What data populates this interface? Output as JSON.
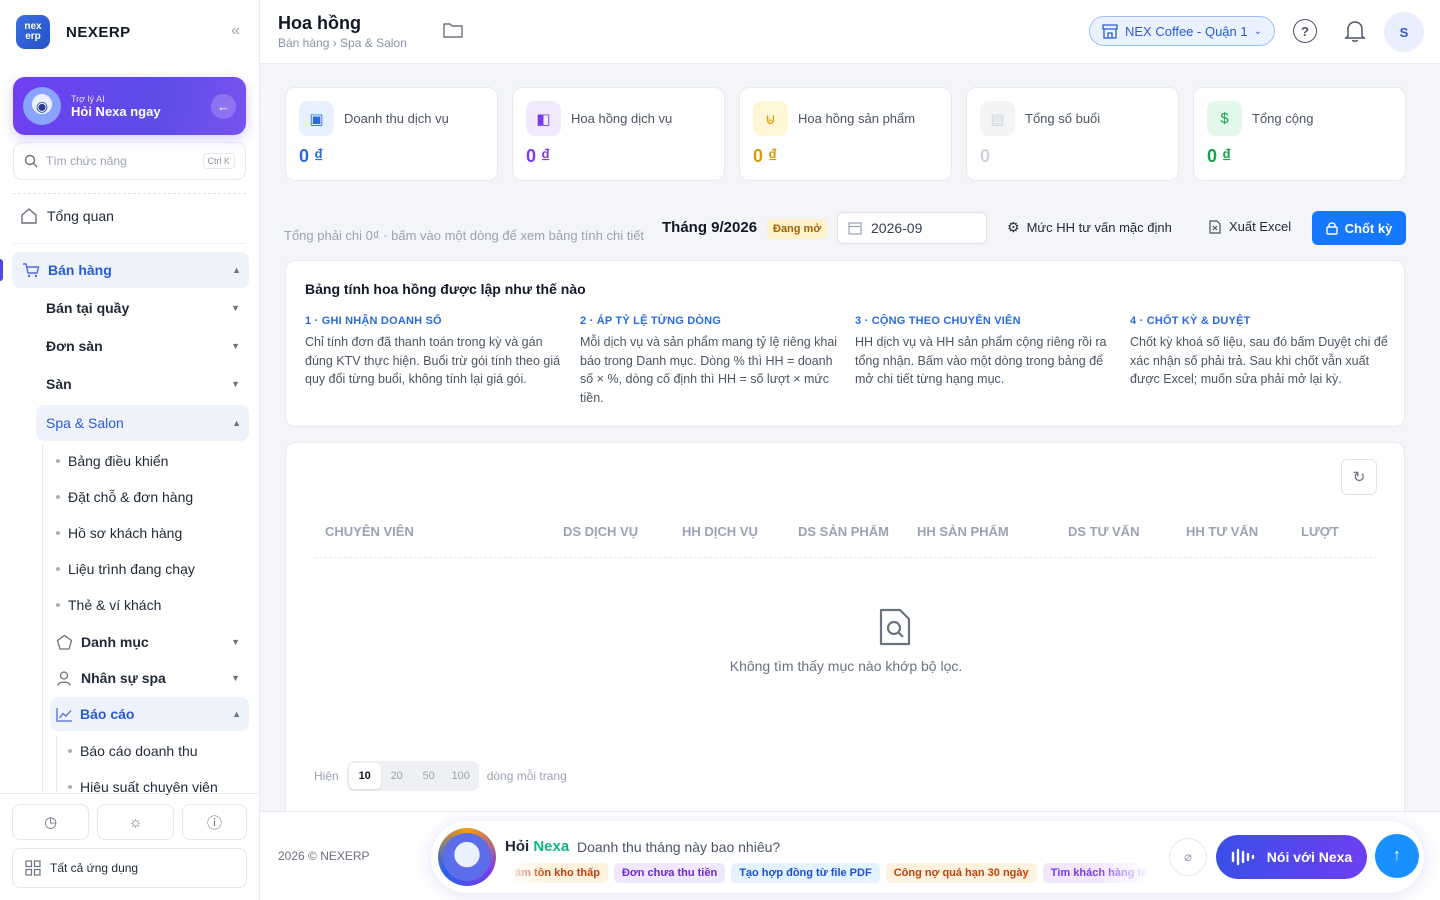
{
  "app": {
    "name": "NEXERP",
    "logo_text": "nex erp"
  },
  "ai_card": {
    "small": "Trợ lý AI",
    "big": "Hỏi Nexa ngay"
  },
  "search": {
    "placeholder": "Tìm chức năng",
    "shortcut": "Ctrl K"
  },
  "nav": {
    "overview": "Tổng quan",
    "sales": "Bán hàng",
    "pos": "Bán tại quầy",
    "marketplace_orders": "Đơn sàn",
    "marketplace": "Sàn",
    "spa": "Spa & Salon",
    "spa_items": [
      "Bảng điều khiển",
      "Đặt chỗ & đơn hàng",
      "Hồ sơ khách hàng",
      "Liệu trình đang chạy",
      "Thẻ & ví khách"
    ],
    "catalog": "Danh mục",
    "staff": "Nhân sự spa",
    "reports": "Báo cáo",
    "report_items": [
      "Báo cáo doanh thu",
      "Hiệu suất chuyên viên"
    ],
    "all_apps": "Tất cả ứng dụng"
  },
  "header": {
    "title": "Hoa hồng",
    "breadcrumb": "Bán hàng › Spa & Salon",
    "store": "NEX Coffee - Quận 1",
    "user_initial": "S"
  },
  "stats": [
    {
      "label": "Doanh thu dịch vụ",
      "value": "0 ₫",
      "color": "#2a6ae0"
    },
    {
      "label": "Hoa hồng dịch vụ",
      "value": "0 ₫",
      "color": "#7c3aed"
    },
    {
      "label": "Hoa hồng sản phẩm",
      "value": "0 ₫",
      "color": "#d99a06"
    },
    {
      "label": "Tổng số buổi",
      "value": "0",
      "color": "#d1d5db"
    },
    {
      "label": "Tổng cộng",
      "value": "0 ₫",
      "color": "#16a34a"
    }
  ],
  "filters": {
    "hint": "Tổng phải chi 0₫ · bấm vào một dòng để xem bảng tính chi tiết",
    "month": "Tháng 9/2026",
    "status": "Đang mở",
    "period": "2026-09",
    "default_rate": "Mức HH tư vấn mặc định",
    "export": "Xuất Excel",
    "close_period": "Chốt kỳ"
  },
  "explain": {
    "title": "Bảng tính hoa hồng được lập như thế nào",
    "steps": [
      {
        "title": "1 · GHI NHẬN DOANH SỐ",
        "text": "Chỉ tính đơn đã thanh toán trong kỳ và gán đúng KTV thực hiện. Buổi trừ gói tính theo giá quy đổi từng buổi, không tính lại giá gói."
      },
      {
        "title": "2 · ÁP TỶ LỆ TỪNG DÒNG",
        "text": "Mỗi dịch vụ và sản phẩm mang tỷ lệ riêng khai báo trong Danh mục. Dòng % thì HH = doanh số × %, dòng cố định thì HH = số lượt × mức tiền."
      },
      {
        "title": "3 · CỘNG THEO CHUYÊN VIÊN",
        "text": "HH dịch vụ và HH sản phẩm cộng riêng rồi ra tổng nhận. Bấm vào một dòng trong bảng để mở chi tiết từng hạng mục."
      },
      {
        "title": "4 · CHỐT KỲ & DUYỆT",
        "text": "Chốt kỳ khoá số liệu, sau đó bấm Duyệt chi để xác nhận số phải trả. Sau khi chốt vẫn xuất được Excel; muốn sửa phải mở lại kỳ."
      }
    ]
  },
  "table": {
    "columns": [
      "CHUYÊN VIÊN",
      "DS DỊCH VỤ",
      "HH DỊCH VỤ",
      "DS SẢN PHẨM",
      "HH SẢN PHẨM",
      "DS TƯ VẤN",
      "HH TƯ VẤN",
      "LƯỢT"
    ],
    "empty": "Không tìm thấy mục nào khớp bộ lọc.",
    "pager_prefix": "Hiện",
    "page_sizes": [
      "10",
      "20",
      "50",
      "100"
    ],
    "selected_page_size": "10",
    "pager_suffix": "dòng mỗi trang"
  },
  "footer": {
    "copyright": "2026 © NEXERP",
    "ask_prefix": "Hỏi",
    "ask_brand": "Nexa",
    "ask_placeholder": "Doanh thu tháng này bao nhiêu?",
    "chips": [
      {
        "label": "ám tồn kho thấp",
        "bg": "#fff3e0",
        "fg": "#c2410c"
      },
      {
        "label": "Đơn chưa thu tiền",
        "bg": "#efe9ff",
        "fg": "#6d28d9"
      },
      {
        "label": "Tạo hợp đồng từ file PDF",
        "bg": "#e5f2ff",
        "fg": "#1d4ed8"
      },
      {
        "label": "Công nợ quá hạn 30 ngày",
        "bg": "#fff3e0",
        "fg": "#c2410c"
      },
      {
        "label": "Tìm khách hàng tê",
        "bg": "#f1e8ff",
        "fg": "#7c3aed"
      }
    ],
    "voice": "Nói với Nexa"
  }
}
